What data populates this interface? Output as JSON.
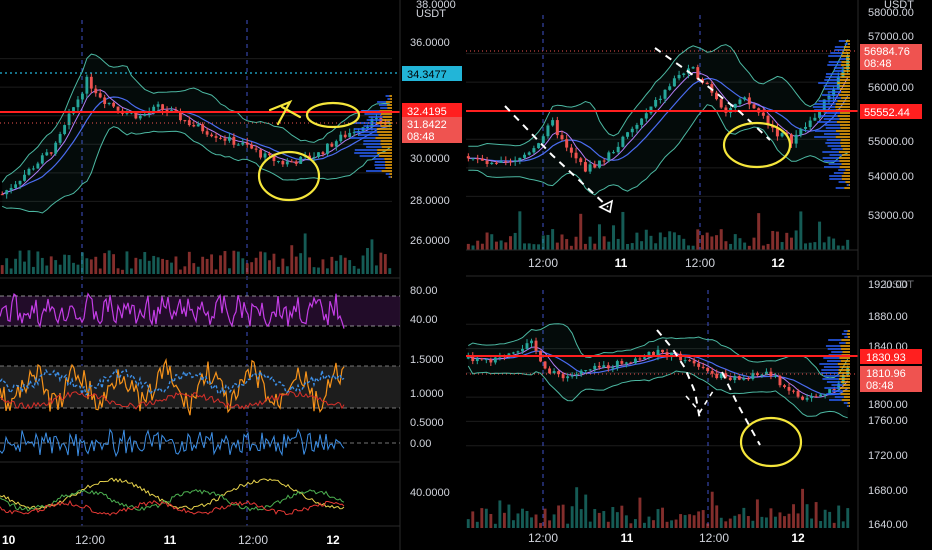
{
  "colors": {
    "background": "#000000",
    "grid": "#1c1c1c",
    "up": "#26a69a",
    "down": "#ef5350",
    "red_line": "#ff1f1f",
    "cyan": "#22b5d8",
    "annotation": "#f5e63b",
    "band": "#4cb8a2",
    "ma_blue": "#4a6cf0",
    "ma_purple": "#b07cf5",
    "axis_text": "#d1d4dc",
    "rsi": "#c43de6",
    "stoch_orange": "#f7931a",
    "stoch_blue": "#3d8fe6",
    "vp_blue": "#2962ff",
    "vp_orange": "#f0a30a"
  },
  "chart_data": [
    {
      "type": "candlestick",
      "panel": "left-price",
      "unit": "USDT",
      "y_ticks": [
        "38.0000",
        "36.0000",
        "30.0000",
        "28.0000",
        "26.0000"
      ],
      "x_ticks": [
        "10",
        "12:00",
        "11",
        "12:00",
        "12"
      ],
      "price_labels": {
        "cyan": "34.3477",
        "red": "32.4195",
        "current": "31.8422",
        "countdown": "08:48"
      },
      "ylim": [
        24.8,
        38.2
      ],
      "path_points": [
        [
          0,
          27.2
        ],
        [
          6,
          28.8
        ],
        [
          12,
          30.4
        ],
        [
          16,
          33
        ],
        [
          19,
          34.8
        ],
        [
          23,
          33.5
        ],
        [
          27,
          32.8
        ],
        [
          31,
          32.4
        ],
        [
          35,
          33
        ],
        [
          39,
          32.5
        ],
        [
          43,
          31.8
        ],
        [
          47,
          31.3
        ],
        [
          51,
          30.8
        ],
        [
          55,
          30.4
        ],
        [
          59,
          29.7
        ],
        [
          63,
          29.3
        ],
        [
          67,
          29.5
        ],
        [
          71,
          29.9
        ],
        [
          75,
          30.8
        ],
        [
          79,
          31.5
        ],
        [
          83,
          32.1
        ],
        [
          87,
          31.9
        ]
      ],
      "annotations": [
        "yellow-hand-drawn-circle",
        "yellow-hand-drawn-circle",
        "yellow-hand-drawn-arrow"
      ]
    },
    {
      "type": "line",
      "panel": "rsi",
      "y_ticks": [
        "80.00",
        "40.00"
      ],
      "ylim": [
        20,
        90
      ]
    },
    {
      "type": "line",
      "panel": "stochastic",
      "y_ticks": [
        "1.5000",
        "1.0000",
        "0.5000"
      ],
      "ylim": [
        0.35,
        1.7
      ]
    },
    {
      "type": "line",
      "panel": "oscillator",
      "y_ticks": [
        "0.00"
      ],
      "ylim": [
        -1,
        1
      ]
    },
    {
      "type": "line",
      "panel": "dmi",
      "y_ticks": [
        "40.0000"
      ],
      "ylim": [
        0,
        80
      ]
    },
    {
      "type": "candlestick",
      "panel": "top-right-price",
      "unit": "USDT",
      "y_ticks": [
        "58000.00",
        "57000.00",
        "56000.00",
        "55000.00",
        "54000.00",
        "53000.00"
      ],
      "x_ticks": [
        "12:00",
        "11",
        "12:00",
        "12"
      ],
      "price_labels": {
        "current": "56984.76",
        "countdown": "08:48",
        "red": "55552.44"
      },
      "ylim": [
        52200,
        58300
      ],
      "path_points": [
        [
          0,
          54300
        ],
        [
          5,
          54000
        ],
        [
          10,
          54100
        ],
        [
          14,
          54600
        ],
        [
          18,
          55300
        ],
        [
          21,
          54500
        ],
        [
          25,
          53900
        ],
        [
          29,
          54200
        ],
        [
          33,
          54800
        ],
        [
          37,
          55400
        ],
        [
          41,
          56100
        ],
        [
          45,
          56800
        ],
        [
          48,
          56900
        ],
        [
          51,
          56500
        ],
        [
          55,
          55700
        ],
        [
          59,
          56000
        ],
        [
          63,
          55500
        ],
        [
          66,
          55000
        ],
        [
          69,
          54800
        ],
        [
          72,
          55200
        ],
        [
          75,
          55700
        ],
        [
          78,
          56400
        ],
        [
          81,
          57300
        ]
      ],
      "annotations": [
        "yellow-hand-drawn-circle",
        "white-dashed-lines"
      ]
    },
    {
      "type": "candlestick",
      "panel": "bottom-right-price",
      "y_ticks": [
        "1920.00",
        "1880.00",
        "1840.00",
        "1800.00",
        "1760.00",
        "1720.00",
        "1680.00",
        "1640.00"
      ],
      "unit_partial": "USDT",
      "x_ticks": [
        "12:00",
        "11",
        "12:00",
        "12"
      ],
      "price_labels": {
        "red": "1830.93",
        "current": "1810.96",
        "countdown": "08:48"
      },
      "ylim": [
        1635,
        1925
      ],
      "path_points": [
        [
          0,
          1825
        ],
        [
          5,
          1818
        ],
        [
          10,
          1840
        ],
        [
          14,
          1850
        ],
        [
          18,
          1800
        ],
        [
          22,
          1795
        ],
        [
          27,
          1805
        ],
        [
          32,
          1815
        ],
        [
          37,
          1825
        ],
        [
          42,
          1835
        ],
        [
          46,
          1830
        ],
        [
          50,
          1822
        ],
        [
          54,
          1800
        ],
        [
          58,
          1790
        ],
        [
          62,
          1792
        ],
        [
          66,
          1802
        ],
        [
          70,
          1778
        ],
        [
          74,
          1755
        ],
        [
          78,
          1762
        ],
        [
          81,
          1778
        ],
        [
          84,
          1805
        ]
      ],
      "annotations": [
        "yellow-hand-drawn-circle",
        "white-dashed-lines"
      ]
    }
  ]
}
